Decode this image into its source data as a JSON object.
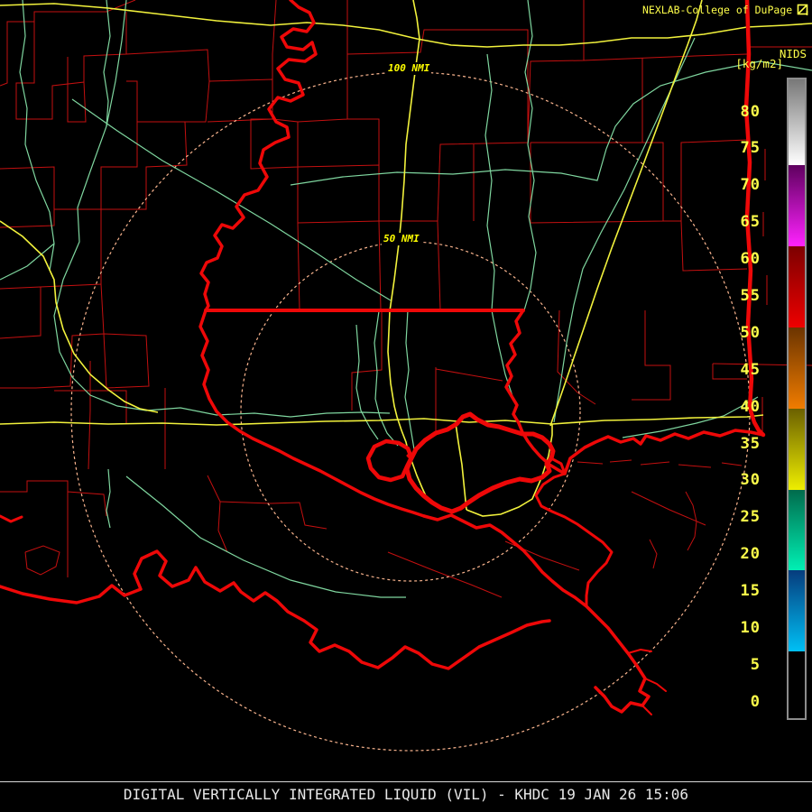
{
  "header": {
    "title": "NEXLAB-College of DuPage",
    "logo_icon": "cod-flag-icon"
  },
  "scale": {
    "title": "NIDS",
    "units": "[kg/m2]",
    "value_top": 84.6,
    "value_bottom": -2,
    "ticks": [
      80,
      75,
      70,
      65,
      60,
      55,
      50,
      45,
      40,
      35,
      30,
      25,
      20,
      15,
      10,
      5,
      0
    ],
    "segments": [
      {
        "from": 84.6,
        "to": 73,
        "color_top": "#787878",
        "color_bottom": "#ffffff"
      },
      {
        "from": 73,
        "to": 62,
        "color_top": "#5e005e",
        "color_bottom": "#ff22ff"
      },
      {
        "from": 62,
        "to": 51,
        "color_top": "#7c0000",
        "color_bottom": "#ee0000"
      },
      {
        "from": 51,
        "to": 40,
        "color_top": "#6b3400",
        "color_bottom": "#f07c00"
      },
      {
        "from": 40,
        "to": 29,
        "color_top": "#6b6000",
        "color_bottom": "#eeee00"
      },
      {
        "from": 29,
        "to": 18,
        "color_top": "#006b4c",
        "color_bottom": "#00f0b4"
      },
      {
        "from": 18,
        "to": 7,
        "color_top": "#063c7d",
        "color_bottom": "#00c0f5"
      },
      {
        "from": 7,
        "to": -2,
        "color_top": "#000000",
        "color_bottom": "#000000"
      }
    ]
  },
  "rings": [
    {
      "label": "100 NMI"
    },
    {
      "label": "50 NMI"
    }
  ],
  "footer": {
    "caption": "DIGITAL VERTICALLY INTEGRATED LIQUID (VIL) - KHDC 19 JAN 26 15:06"
  },
  "map_colors": {
    "background": "#000000",
    "county": "#c31010",
    "state_coast": "#ee0808",
    "river": "#7fd69f",
    "highway": "#f2f23c",
    "range_ring": "#f9b48e",
    "label_yellow": "#ffff4a",
    "caption_white": "#e8e8e8"
  }
}
